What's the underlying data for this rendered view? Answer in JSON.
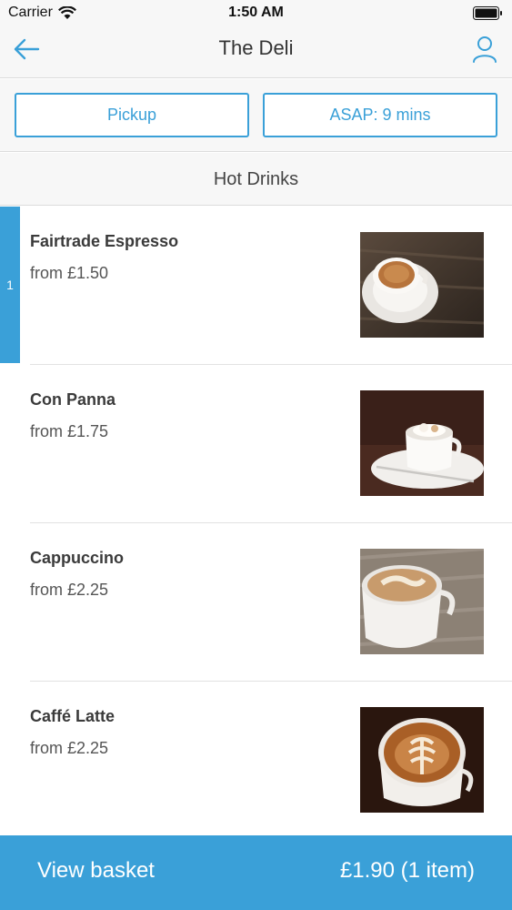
{
  "status_bar": {
    "carrier": "Carrier",
    "time": "1:50 AM"
  },
  "nav": {
    "title": "The Deli",
    "back_icon": "arrow-left-icon",
    "profile_icon": "user-icon"
  },
  "options": {
    "mode": "Pickup",
    "time": "ASAP: 9 mins"
  },
  "category": {
    "title": "Hot Drinks"
  },
  "items": [
    {
      "name": "Fairtrade Espresso",
      "price": "from £1.50",
      "quantity": "1"
    },
    {
      "name": "Con Panna",
      "price": "from £1.75"
    },
    {
      "name": "Cappuccino",
      "price": "from £2.25"
    },
    {
      "name": "Caffé Latte",
      "price": "from £2.25"
    }
  ],
  "basket": {
    "label": "View basket",
    "total": "£1.90 (1 item)"
  },
  "colors": {
    "accent": "#3aa0d8",
    "nav_bg": "#f7f7f7",
    "text": "#3a3a3a"
  }
}
